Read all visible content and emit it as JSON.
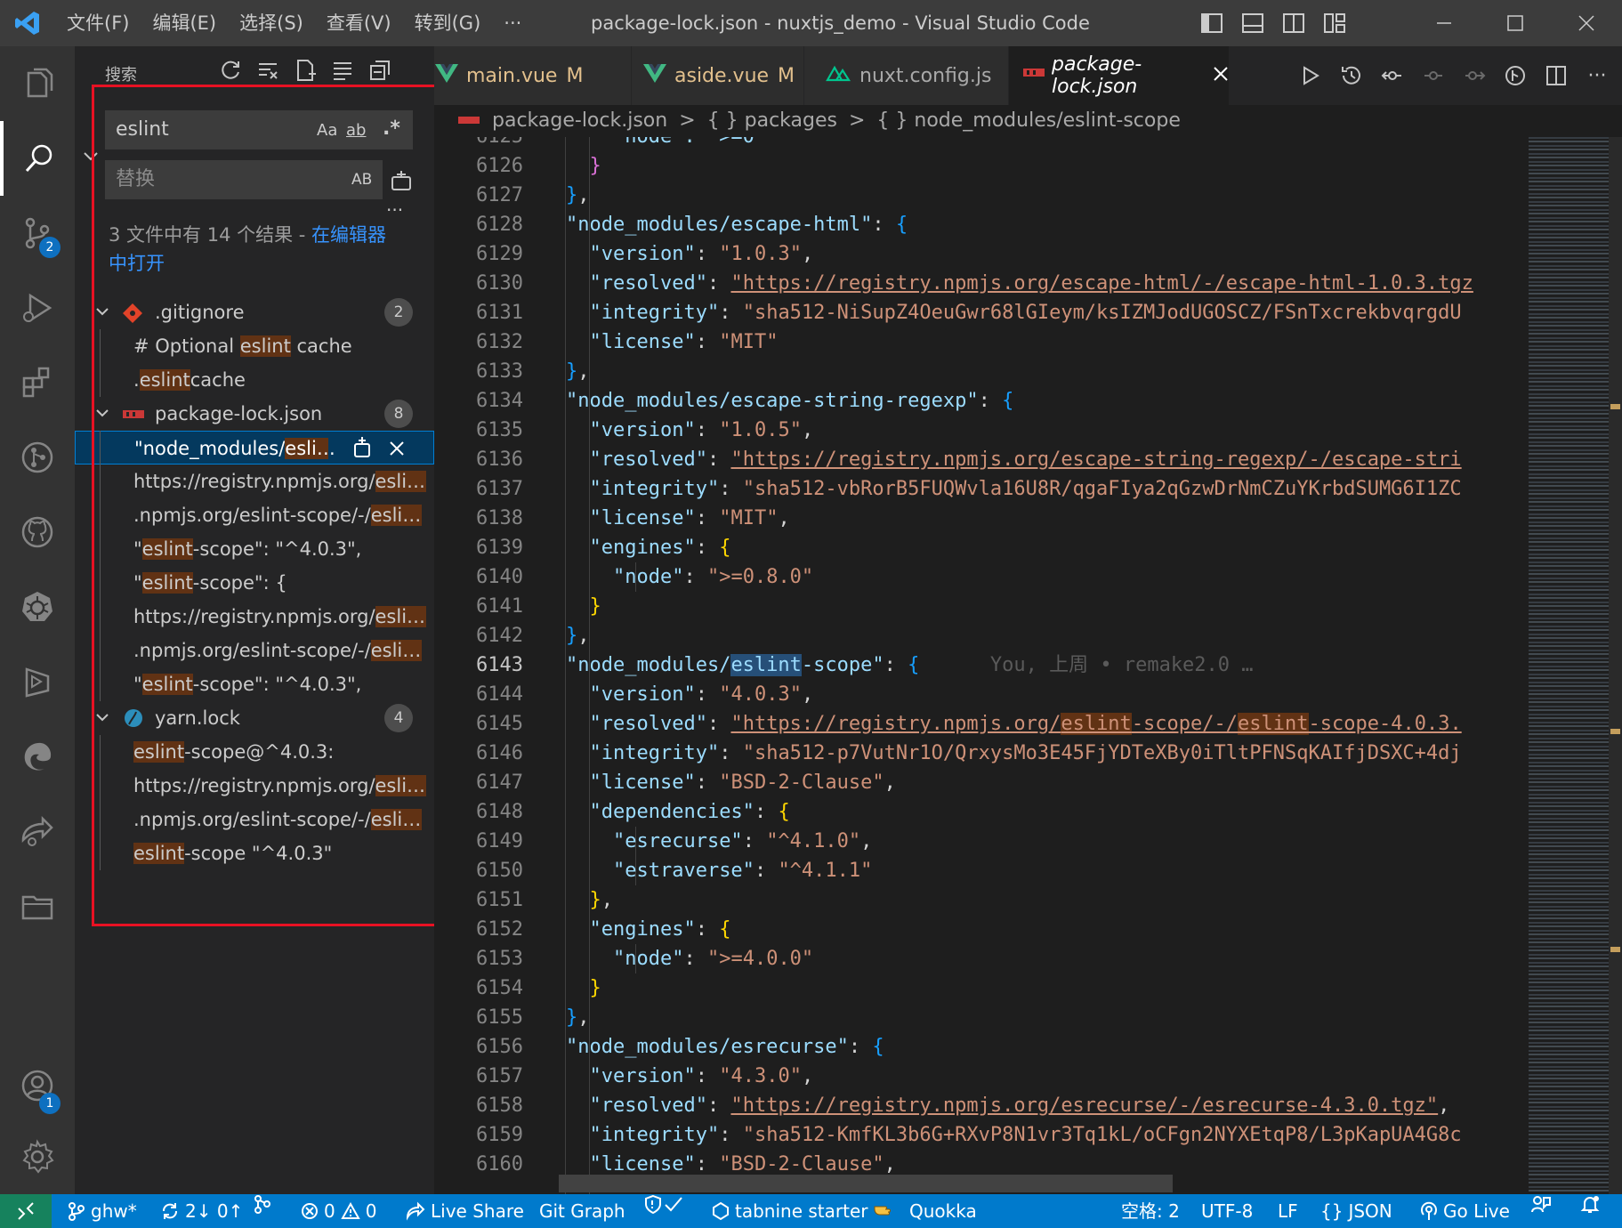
{
  "titlebar": {
    "menu": [
      "文件(F)",
      "编辑(E)",
      "选择(S)",
      "查看(V)",
      "转到(G)",
      "···"
    ],
    "title": "package-lock.json - nuxtjs_demo - Visual Studio Code"
  },
  "activity_badges": {
    "scm": "2",
    "accounts": "1"
  },
  "search": {
    "title": "搜索",
    "query": "eslint",
    "replace_placeholder": "替换",
    "opt_case": "Aa",
    "opt_word": "ab",
    "opt_regex": ".*",
    "opt_preserve_case": "AB",
    "summary_prefix": "3 文件中有 14 个结果 - ",
    "summary_link": "在编辑器中打开",
    "files": [
      {
        "name": ".gitignore",
        "count": "2"
      },
      {
        "name": "package-lock.json",
        "count": "8"
      },
      {
        "name": "yarn.lock",
        "count": "4"
      }
    ],
    "matches": {
      "g1_pre": "# Optional ",
      "g1_hl": "eslint",
      "g1_post": " cache",
      "g2_pre": ".",
      "g2_hl": "eslint",
      "g2_post": "cache",
      "p1_pre": "\"node_modules/",
      "p1_hl": "eslin",
      "p1_post": "...",
      "p2_pre": "https://registry.npmjs.org/",
      "p2_hl": "eslint",
      "p2_post": "...",
      "p3_pre": ".npmjs.org/eslint-scope/-/",
      "p3_hl": "eslint",
      "p3_post": "...",
      "p4_pre": "\"",
      "p4_hl": "eslint",
      "p4_post": "-scope\": \"^4.0.3\",",
      "p5_pre": "\"",
      "p5_hl": "eslint",
      "p5_post": "-scope\": {",
      "p6_pre": "https://registry.npmjs.org/",
      "p6_hl": "eslint",
      "p6_post": "...",
      "p7_pre": ".npmjs.org/eslint-scope/-/",
      "p7_hl": "eslint",
      "p7_post": "...",
      "p8_pre": "\"",
      "p8_hl": "eslint",
      "p8_post": "-scope\": \"^4.0.3\",",
      "y1_pre": "",
      "y1_hl": "eslint",
      "y1_post": "-scope@^4.0.3:",
      "y2_pre": "https://registry.npmjs.org/",
      "y2_hl": "eslint",
      "y2_post": "...",
      "y3_pre": ".npmjs.org/eslint-scope/-/",
      "y3_hl": "eslint",
      "y3_post": "...",
      "y4_pre": "",
      "y4_hl": "eslint",
      "y4_post": "-scope \"^4.0.3\""
    }
  },
  "tabs": [
    {
      "name": "main.vue",
      "mod": "M"
    },
    {
      "name": "aside.vue",
      "mod": "M"
    },
    {
      "name": "nuxt.config.js",
      "mod": ""
    },
    {
      "name": "package-lock.json",
      "mod": ""
    }
  ],
  "breadcrumb": [
    "package-lock.json",
    ">",
    "{ } packages",
    ">",
    "{ } node_modules/eslint-scope"
  ],
  "editor": {
    "line_numbers": [
      "6125",
      "6126",
      "6127",
      "6128",
      "6129",
      "6130",
      "6131",
      "6132",
      "6133",
      "6134",
      "6135",
      "6136",
      "6137",
      "6138",
      "6139",
      "6140",
      "6141",
      "6142",
      "6143",
      "6144",
      "6145",
      "6146",
      "6147",
      "6148",
      "6149",
      "6150",
      "6151",
      "6152",
      "6153",
      "6154",
      "6155",
      "6156",
      "6157",
      "6158",
      "6159",
      "6160"
    ],
    "current_line": "6143",
    "blame": "You, 上周 • remake2.0 …",
    "l6125": "\"node\": \">=0",
    "l6128_key": "\"node_modules/escape-html\"",
    "l6129_val": "\"1.0.3\"",
    "l6130_val": "\"https://registry.npmjs.org/escape-html/-/escape-html-1.0.3.tgz",
    "l6131_val": "\"sha512-NiSupZ4OeuGwr68lGIeym/ksIZMJodUGOSCZ/FSnTxcrekbvqrgdU",
    "l6132_val": "\"MIT\"",
    "l6134_key": "\"node_modules/escape-string-regexp\"",
    "l6135_val": "\"1.0.5\"",
    "l6136_val": "\"https://registry.npmjs.org/escape-string-regexp/-/escape-stri",
    "l6137_val": "\"sha512-vbRorB5FUQWvla16U8R/qgaFIya2qGzwDrNmCZuYKrbdSUMG6I1ZC",
    "l6138_val": "\"MIT\"",
    "l6140_val": "\">=0.8.0\"",
    "l6143_pre": "\"node_modules/",
    "l6143_hl": "eslint",
    "l6143_post": "-scope\"",
    "l6144_val": "\"4.0.3\"",
    "l6145_a": "\"https://registry.npmjs.org/",
    "l6145_b": "eslint",
    "l6145_c": "-scope/-/",
    "l6145_d": "eslint",
    "l6145_e": "-scope-4.0.3.",
    "l6146_val": "\"sha512-p7VutNr1O/QrxysMo3E45FjYDTeXBy0iTltPFNSqKAIfjDSXC+4dj",
    "l6147_val": "\"BSD-2-Clause\"",
    "l6149_key": "\"esrecurse\"",
    "l6149_val": "\"^4.1.0\"",
    "l6150_key": "\"estraverse\"",
    "l6150_val": "\"^4.1.1\"",
    "l6153_val": "\">=4.0.0\"",
    "l6156_key": "\"node_modules/esrecurse\"",
    "l6157_val": "\"4.3.0\"",
    "l6158_val": "\"https://registry.npmjs.org/esrecurse/-/esrecurse-4.3.0.tgz\"",
    "l6159_val": "\"sha512-KmfKL3b6G+RXvP8N1vr3Tq1kL/oCFgn2NYXEtqP8/L3pKapUA4G8c",
    "l6160_val": "\"BSD-2-Clause\"",
    "k_version": "\"version\"",
    "k_resolved": "\"resolved\"",
    "k_integrity": "\"integrity\"",
    "k_license": "\"license\"",
    "k_engines": "\"engines\"",
    "k_node": "\"node\"",
    "k_dependencies": "\"dependencies\""
  },
  "statusbar": {
    "branch": "ghw*",
    "sync": "2↓ 0↑",
    "errors": "0",
    "warnings": "0",
    "live_share": "Live Share",
    "git_graph": "Git Graph",
    "tabnine": "tabnine starter",
    "quokka": "Quokka",
    "spaces": "空格: 2",
    "encoding": "UTF-8",
    "eol": "LF",
    "language": "JSON",
    "go_live": "Go Live"
  }
}
